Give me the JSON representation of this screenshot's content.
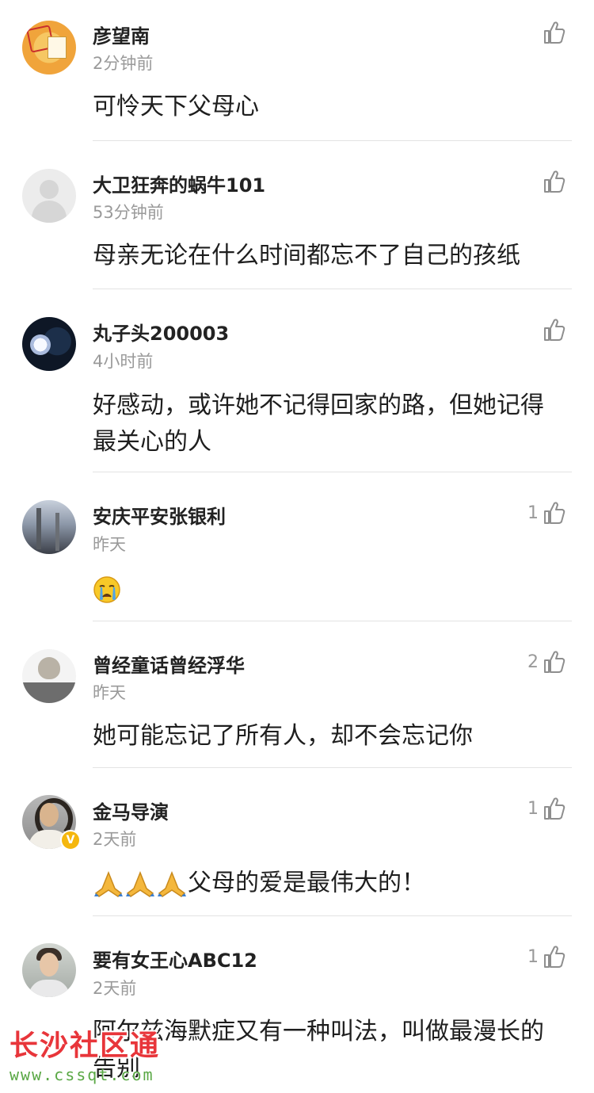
{
  "comments": [
    {
      "username": "彦望南",
      "time": "2分钟前",
      "text": "可怜天下父母心",
      "likes": "",
      "emojis": ""
    },
    {
      "username": "大卫狂奔的蜗牛101",
      "time": "53分钟前",
      "text": "母亲无论在什么时间都忘不了自己的孩纸",
      "likes": "",
      "emojis": ""
    },
    {
      "username": "丸子头200003",
      "time": "4小时前",
      "text": "好感动，或许她不记得回家的路，但她记得最关心的人",
      "likes": "",
      "emojis": ""
    },
    {
      "username": "安庆平安张银利",
      "time": "昨天",
      "text": "",
      "likes": "1",
      "emojis": "crying-face"
    },
    {
      "username": "曾经童话曾经浮华",
      "time": "昨天",
      "text": "她可能忘记了所有人，却不会忘记你",
      "likes": "2",
      "emojis": ""
    },
    {
      "username": "金马导演",
      "time": "2天前",
      "text": "父母的爱是最伟大的！",
      "likes": "1",
      "emojis": "folded-hands x3",
      "verified": "V"
    },
    {
      "username": "要有女王心ABC12",
      "time": "2天前",
      "text": "阿尔兹海默症又有一种叫法，叫做最漫长的告别",
      "likes": "1",
      "emojis": ""
    }
  ],
  "watermark": {
    "title": "长沙社区通",
    "url": "www.cssqt.com"
  },
  "icons": {
    "like": "thumbs-up-icon"
  },
  "colors": {
    "text": "#1e1e1e",
    "muted": "#9a9a9a",
    "divider": "#e3e3e3",
    "watermark_red": "#e8353a",
    "watermark_green": "#5aa845"
  }
}
